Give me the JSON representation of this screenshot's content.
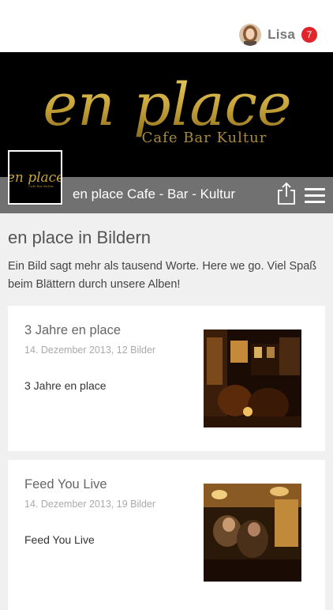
{
  "header": {
    "user_name": "Lisa",
    "notification_count": "7",
    "badge_color": "#e0242c"
  },
  "banner": {
    "logo_text": "en place",
    "logo_subtitle": "Cafe Bar Kultur",
    "logo_color": "#c9a63a"
  },
  "page_bar": {
    "page_name": "en place Cafe - Bar - Kultur",
    "share_icon": "share-icon",
    "menu_icon": "hamburger-menu-icon"
  },
  "main": {
    "heading": "en place in Bildern",
    "intro": "Ein Bild sagt mehr als tausend Worte. Here we go. Viel Spaß beim Blättern durch unsere Alben!",
    "albums": [
      {
        "title": "3 Jahre en place",
        "meta": "14. Dezember 2013, 12 Bilder",
        "description": "3 Jahre en place"
      },
      {
        "title": "Feed You Live",
        "meta": "14. Dezember 2013, 19 Bilder",
        "description": "Feed You Live"
      }
    ]
  }
}
